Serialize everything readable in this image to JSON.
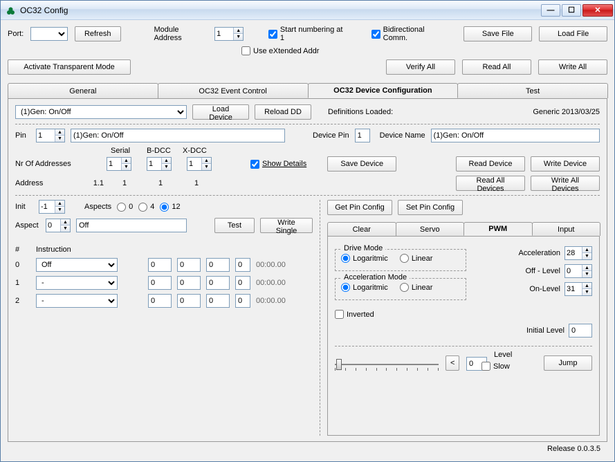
{
  "window": {
    "title": "OC32 Config"
  },
  "toolbar": {
    "port_label": "Port:",
    "port_value": "",
    "refresh": "Refresh",
    "module_addr_label": "Module Address",
    "module_addr_value": "1",
    "start_numbering": "Start numbering at 1",
    "bidirectional": "Bidirectional Comm.",
    "use_extended": "Use eXtended Addr",
    "save_file": "Save File",
    "load_file": "Load File",
    "activate_transparent": "Activate Transparent Mode",
    "verify_all": "Verify All",
    "read_all": "Read All",
    "write_all": "Write All"
  },
  "tabs": {
    "general": "General",
    "event": "OC32 Event Control",
    "device": "OC32 Device Configuration",
    "test": "Test"
  },
  "devtab": {
    "device_select": "(1)Gen: On/Off",
    "load_device": "Load Device",
    "reload_dd": "Reload DD",
    "defs_loaded_label": "Definitions Loaded:",
    "defs_loaded_value": "Generic 2013/03/25",
    "pin_label": "Pin",
    "pin_value": "1",
    "pin_name": "(1)Gen: On/Off",
    "device_pin_label": "Device Pin",
    "device_pin_value": "1",
    "device_name_label": "Device Name",
    "device_name_value": "(1)Gen: On/Off",
    "nr_addr_label": "Nr Of Addresses",
    "serial_label": "Serial",
    "serial_value": "1",
    "bdcc_label": "B-DCC",
    "bdcc_value": "1",
    "xdcc_label": "X-DCC",
    "xdcc_value": "1",
    "show_details": "Show Details",
    "save_device": "Save Device",
    "read_device": "Read Device",
    "write_device": "Write Device",
    "read_all_devices": "Read All Devices",
    "write_all_devices": "Write All Devices",
    "address_label": "Address",
    "address_value": "1.1",
    "addr_serial": "1",
    "addr_bdcc": "1",
    "addr_xdcc": "1"
  },
  "aspectsec": {
    "init_label": "Init",
    "init_value": "-1",
    "aspects_label": "Aspects",
    "aspects_options": [
      "0",
      "4",
      "12"
    ],
    "aspects_selected": "12",
    "aspect_label": "Aspect",
    "aspect_value": "0",
    "aspect_name": "Off",
    "test_btn": "Test",
    "write_single": "Write Single",
    "hash": "#",
    "instruction_label": "Instruction",
    "rows": [
      {
        "idx": "0",
        "instr": "Off",
        "v1": "0",
        "v2": "0",
        "v3": "0",
        "v4": "0",
        "time": "00:00.00"
      },
      {
        "idx": "1",
        "instr": "-",
        "v1": "0",
        "v2": "0",
        "v3": "0",
        "v4": "0",
        "time": "00:00.00"
      },
      {
        "idx": "2",
        "instr": "-",
        "v1": "0",
        "v2": "0",
        "v3": "0",
        "v4": "0",
        "time": "00:00.00"
      }
    ]
  },
  "pincfg": {
    "get": "Get Pin Config",
    "set": "Set Pin Config",
    "tabs": {
      "clear": "Clear",
      "servo": "Servo",
      "pwm": "PWM",
      "input": "Input"
    },
    "drive_mode_label": "Drive Mode",
    "accel_mode_label": "Acceleration Mode",
    "logarithmic": "Logaritmic",
    "linear": "Linear",
    "inverted": "Inverted",
    "acceleration_label": "Acceleration",
    "acceleration_value": "28",
    "offlevel_label": "Off - Level",
    "offlevel_value": "0",
    "onlevel_label": "On-Level",
    "onlevel_value": "31",
    "initial_level_label": "Initial Level",
    "initial_level_value": "0",
    "level_label": "Level",
    "level_value": "0",
    "slow_label": "Slow",
    "jump": "Jump",
    "slider_left": "<"
  },
  "footer": {
    "release": "Release 0.0.3.5"
  }
}
